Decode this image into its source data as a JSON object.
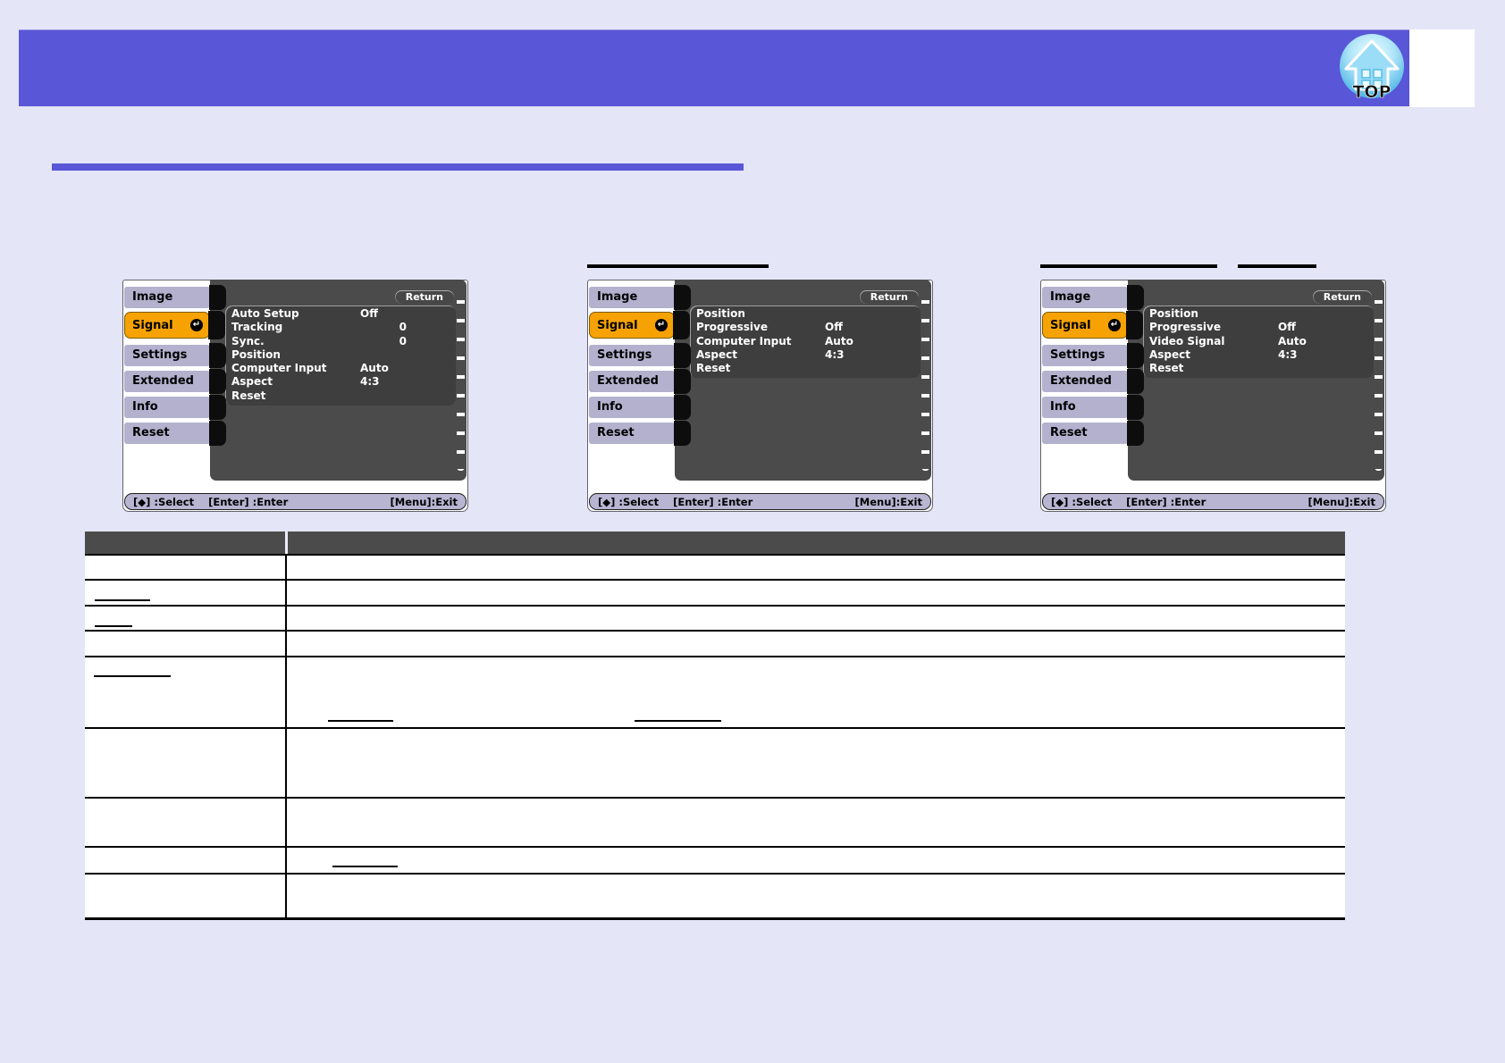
{
  "header": {
    "top_label": "TOP"
  },
  "colors": {
    "page_bg": "#e4e5f7",
    "header_bar": "#5957d7",
    "section_rule": "#5957d7",
    "tab_bg": "#b3b1ce",
    "selected_tab_bg": "#f5a202",
    "osd_panel_bg": "#4b4b4b",
    "osd_items_bg": "#3e3e3e",
    "statusbar_bg": "#b7b5d2",
    "table_header_bg": "#4b4b4b"
  },
  "menus": [
    {
      "tabs": [
        {
          "label": "Image",
          "selected": false
        },
        {
          "label": "Signal",
          "selected": true
        },
        {
          "label": "Settings",
          "selected": false
        },
        {
          "label": "Extended",
          "selected": false
        },
        {
          "label": "Info",
          "selected": false
        },
        {
          "label": "Reset",
          "selected": false
        }
      ],
      "enter_icon": "↵",
      "return_label": "Return",
      "items": [
        {
          "label": "Auto Setup",
          "value": "Off",
          "numeric": false
        },
        {
          "label": "Tracking",
          "value": "0",
          "numeric": true
        },
        {
          "label": "Sync.",
          "value": "0",
          "numeric": true
        },
        {
          "label": "Position",
          "value": "",
          "numeric": false
        },
        {
          "label": "Computer Input",
          "value": "Auto",
          "numeric": false
        },
        {
          "label": "Aspect",
          "value": "4:3",
          "numeric": false
        },
        {
          "label": "Reset",
          "value": "",
          "numeric": false
        }
      ],
      "statusbar": {
        "select": "[◆] :Select",
        "enter": "[Enter] :Enter",
        "exit": "[Menu]:Exit"
      }
    },
    {
      "tabs": [
        {
          "label": "Image",
          "selected": false
        },
        {
          "label": "Signal",
          "selected": true
        },
        {
          "label": "Settings",
          "selected": false
        },
        {
          "label": "Extended",
          "selected": false
        },
        {
          "label": "Info",
          "selected": false
        },
        {
          "label": "Reset",
          "selected": false
        }
      ],
      "enter_icon": "↵",
      "return_label": "Return",
      "items": [
        {
          "label": "Position",
          "value": "",
          "numeric": false
        },
        {
          "label": "Progressive",
          "value": "Off",
          "numeric": false
        },
        {
          "label": "Computer Input",
          "value": "Auto",
          "numeric": false
        },
        {
          "label": "Aspect",
          "value": "4:3",
          "numeric": false
        },
        {
          "label": "Reset",
          "value": "",
          "numeric": false
        }
      ],
      "statusbar": {
        "select": "[◆] :Select",
        "enter": "[Enter] :Enter",
        "exit": "[Menu]:Exit"
      }
    },
    {
      "tabs": [
        {
          "label": "Image",
          "selected": false
        },
        {
          "label": "Signal",
          "selected": true
        },
        {
          "label": "Settings",
          "selected": false
        },
        {
          "label": "Extended",
          "selected": false
        },
        {
          "label": "Info",
          "selected": false
        },
        {
          "label": "Reset",
          "selected": false
        }
      ],
      "enter_icon": "↵",
      "return_label": "Return",
      "items": [
        {
          "label": "Position",
          "value": "",
          "numeric": false
        },
        {
          "label": "Progressive",
          "value": "Off",
          "numeric": false
        },
        {
          "label": "Video Signal",
          "value": "Auto",
          "numeric": false
        },
        {
          "label": "Aspect",
          "value": "4:3",
          "numeric": false
        },
        {
          "label": "Reset",
          "value": "",
          "numeric": false
        }
      ],
      "statusbar": {
        "select": "[◆] :Select",
        "enter": "[Enter] :Enter",
        "exit": "[Menu]:Exit"
      }
    }
  ]
}
